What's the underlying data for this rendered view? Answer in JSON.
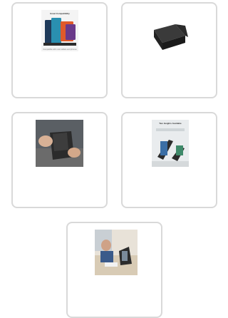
{
  "gallery": {
    "items": [
      {
        "icon": "stand-compatibility-image",
        "heading": "Great Compatibility",
        "caption": "Compatible with most tablets and phones"
      },
      {
        "icon": "folded-stand-image"
      },
      {
        "icon": "stand-in-hand-image"
      },
      {
        "icon": "stand-heights-image",
        "heading": "Two Heights Available"
      },
      {
        "icon": "stand-on-desk-image"
      }
    ]
  },
  "colors": {
    "card_border": "#d9d9d9",
    "stand": "#2b2b2b"
  }
}
